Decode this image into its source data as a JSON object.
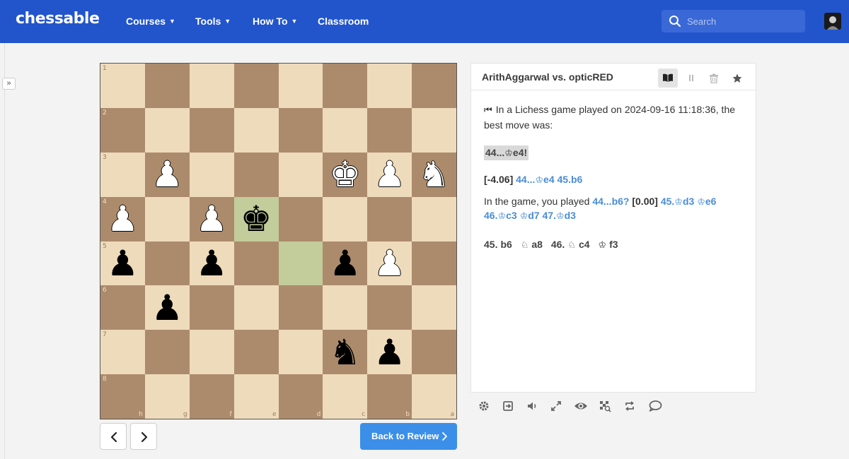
{
  "nav": {
    "logo": "chessable",
    "items": [
      "Courses",
      "Tools",
      "How To",
      "Classroom"
    ],
    "search_placeholder": "Search"
  },
  "board": {
    "ranks": [
      "1",
      "2",
      "3",
      "4",
      "5",
      "6",
      "7",
      "8"
    ],
    "files": [
      "h",
      "g",
      "f",
      "e",
      "d",
      "c",
      "b",
      "a"
    ],
    "highlighted_squares": [
      "e4",
      "d5"
    ],
    "pieces": {
      "g3": "wp",
      "c3": "wk",
      "b3": "wp",
      "a3": "wn",
      "h4": "wp",
      "f4": "wp",
      "e4": "bk",
      "h5": "bp",
      "f5": "bp",
      "c5": "bp",
      "b5": "wp",
      "g6": "bp",
      "c7": "bn",
      "b7": "bp"
    }
  },
  "controls": {
    "back_to_review": "Back to Review"
  },
  "panel": {
    "title": "ArithAggarwal vs. opticRED",
    "intro_prefix": "⏮",
    "intro_text": "In a Lichess game played on 2024-09-16 11:18:36, the best move was:",
    "best_move_num": "44...",
    "best_move_fig": "♔",
    "best_move_sq": "e4!",
    "eval": "[-4.06]",
    "eval_line_a": "44...",
    "eval_line_fig": "♔",
    "eval_line_b": "e4 45.b6",
    "game_prefix": "In the game, you played",
    "played_move": "44...b6?",
    "played_eval": "[0.00]",
    "played_cont": [
      {
        "num": "45.",
        "fig": "♔",
        "sq": "d3"
      },
      {
        "num": "",
        "fig": "♔",
        "sq": "e6"
      },
      {
        "num": "46.",
        "fig": "♔",
        "sq": "c3"
      },
      {
        "num": "",
        "fig": "♔",
        "sq": "d7"
      },
      {
        "num": "47.",
        "fig": "♔",
        "sq": "d3"
      }
    ],
    "next_line": [
      {
        "num": "45.",
        "fig": "",
        "sq": "b6"
      },
      {
        "num": "",
        "fig": "♘",
        "sq": "a8"
      },
      {
        "num": "46.",
        "fig": "♘",
        "sq": "c4"
      },
      {
        "num": "",
        "fig": "♔",
        "sq": "f3"
      }
    ]
  },
  "colors": {
    "brand_blue": "#2255cc",
    "light_square": "#eedbbb",
    "dark_square": "#ac8b6c",
    "highlight": "#c3cc9b",
    "link_blue": "#4a8dd6"
  },
  "icons": {
    "header": [
      "book-icon",
      "pause-icon",
      "trash-icon",
      "star-icon"
    ],
    "tools": [
      "gear-icon",
      "export-icon",
      "volume-icon",
      "expand-icon",
      "eye-icon",
      "analysis-board-icon",
      "flip-board-icon",
      "comment-icon"
    ]
  }
}
